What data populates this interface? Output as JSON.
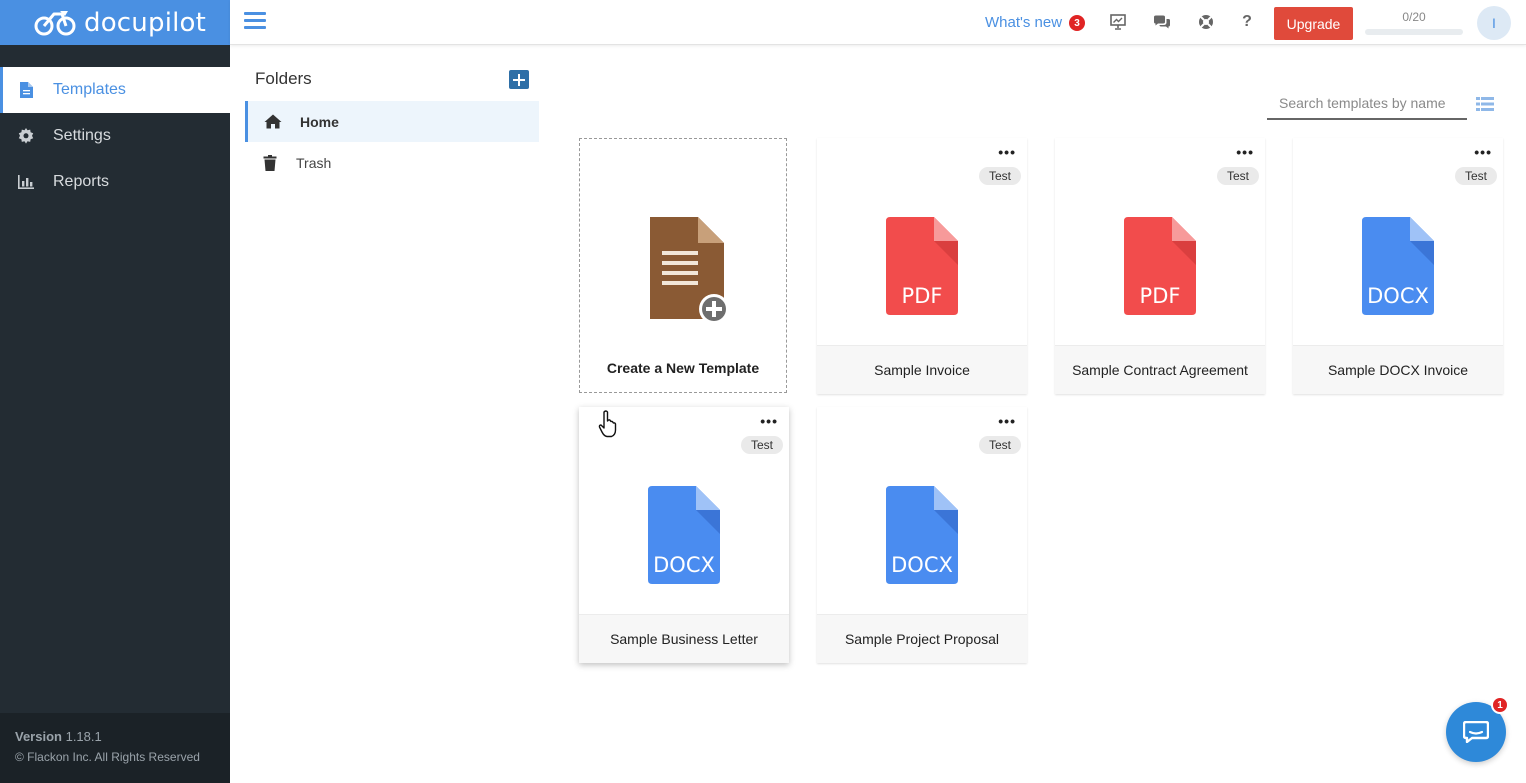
{
  "app": {
    "logo_text": "docupilot"
  },
  "sidebar": {
    "items": [
      {
        "label": "Templates",
        "icon": "file-icon",
        "active": true
      },
      {
        "label": "Settings",
        "icon": "gear-icon",
        "active": false
      },
      {
        "label": "Reports",
        "icon": "bar-chart-icon",
        "active": false
      }
    ],
    "version_label": "Version",
    "version_number": "1.18.1",
    "copyright": "© Flackon Inc. All Rights Reserved"
  },
  "topbar": {
    "whats_new_label": "What's new",
    "whats_new_count": "3",
    "upgrade_label": "Upgrade",
    "usage_text": "0/20",
    "usage_fraction": 0,
    "avatar_initial": "I"
  },
  "folders": {
    "title": "Folders",
    "items": [
      {
        "label": "Home",
        "icon": "home-icon",
        "active": true
      },
      {
        "label": "Trash",
        "icon": "trash-icon",
        "active": false
      }
    ]
  },
  "search": {
    "placeholder": "Search templates by name"
  },
  "create_card": {
    "label": "Create a New Template"
  },
  "templates": [
    {
      "name": "Sample Invoice",
      "type": "PDF",
      "tag": "Test",
      "color": "#f24c4c"
    },
    {
      "name": "Sample Contract Agreement",
      "type": "PDF",
      "tag": "Test",
      "color": "#f24c4c"
    },
    {
      "name": "Sample DOCX Invoice",
      "type": "DOCX",
      "tag": "Test",
      "color": "#4a8cf0"
    },
    {
      "name": "Sample Business Letter",
      "type": "DOCX",
      "tag": "Test",
      "color": "#4a8cf0"
    },
    {
      "name": "Sample Project Proposal",
      "type": "DOCX",
      "tag": "Test",
      "color": "#4a8cf0"
    }
  ],
  "chat": {
    "unread": "1"
  },
  "colors": {
    "accent": "#4a90e2",
    "upgrade": "#e04a3b",
    "sidebar_bg": "#232c33",
    "pdf": "#f24c4c",
    "docx": "#4a8cf0"
  }
}
